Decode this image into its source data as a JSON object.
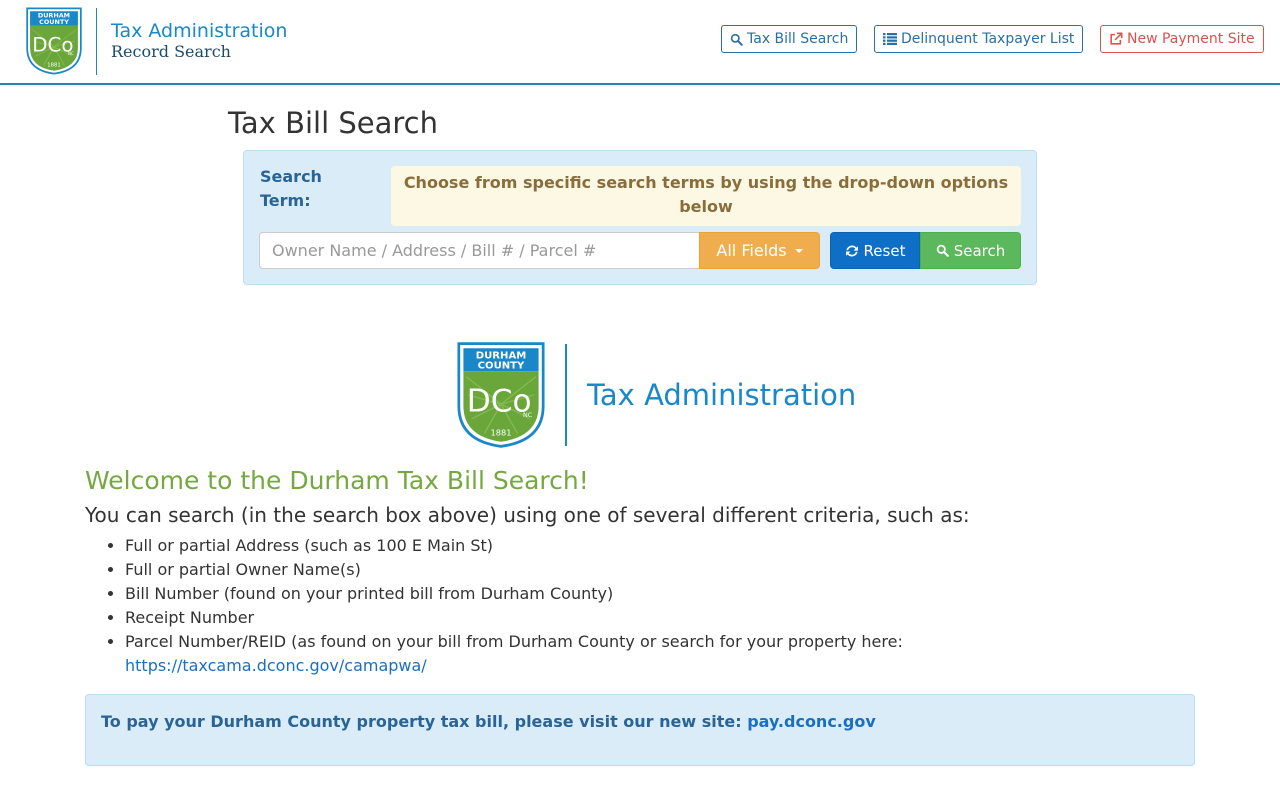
{
  "header": {
    "logo": {
      "top_text_1": "DURHAM",
      "top_text_2": "COUNTY",
      "monogram": "DCo",
      "state": "NC",
      "year": "1881"
    },
    "brand_line1": "Tax Administration",
    "brand_line2": "Record Search",
    "nav": [
      {
        "label": "Tax Bill Search",
        "icon": "search-icon"
      },
      {
        "label": "Delinquent Taxpayer List",
        "icon": "list-icon"
      },
      {
        "label": "New Payment Site",
        "icon": "external-link-icon"
      }
    ]
  },
  "search": {
    "page_title": "Tax Bill Search",
    "label": "Search Term:",
    "hint": "Choose from specific search terms by using the drop-down options below",
    "placeholder": "Owner Name / Address / Bill # / Parcel #",
    "value": "",
    "fields_dropdown": "All Fields",
    "reset_label": "Reset",
    "search_label": "Search"
  },
  "center_logo": {
    "text": "Tax Administration"
  },
  "welcome": {
    "title": "Welcome to the Durham Tax Bill Search!",
    "intro": "You can search (in the search box above) using one of several different criteria, such as:",
    "items": [
      "Full or partial Address (such as 100 E Main St)",
      "Full or partial Owner Name(s)",
      "Bill Number (found on your printed bill from Durham County)",
      "Receipt Number",
      "Parcel Number/REID (as found on your bill from Durham County or search for your property here:"
    ],
    "parcel_link": "https://taxcama.dconc.gov/camapwa/"
  },
  "pay_alert": {
    "text": "To pay your Durham County property tax bill, please visit our new site:",
    "link": "pay.dconc.gov"
  },
  "colors": {
    "primary_blue": "#1a87c9",
    "header_rule": "#2a7fb6",
    "welcome_green": "#75a93f",
    "warning_orange": "#f0ad4e",
    "reset_blue": "#0f6fc6",
    "search_green": "#5cb85c",
    "danger_red": "#d9534f",
    "panel_blue": "#d9ecf7"
  }
}
